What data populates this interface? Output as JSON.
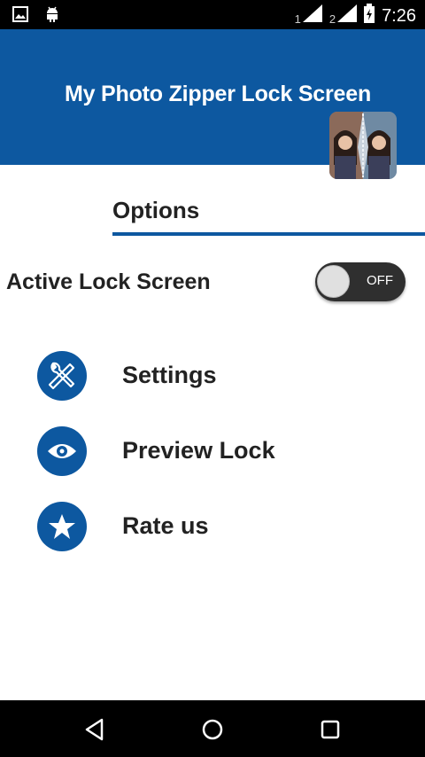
{
  "status_bar": {
    "sim1": "1",
    "sim2": "2",
    "time": "7:26",
    "icons": [
      "gallery-icon",
      "android-icon",
      "signal-icon",
      "signal-icon",
      "battery-icon"
    ]
  },
  "header": {
    "title": "My Photo Zipper Lock Screen",
    "color": "#0d58a0"
  },
  "options": {
    "title": "Options"
  },
  "active_lock": {
    "label": "Active Lock Screen",
    "toggle_text": "OFF",
    "enabled": false
  },
  "menu": [
    {
      "label": "Settings",
      "icon": "tools-icon"
    },
    {
      "label": "Preview Lock",
      "icon": "eye-icon"
    },
    {
      "label": "Rate us",
      "icon": "star-icon"
    }
  ],
  "nav": {
    "icons": [
      "back-icon",
      "home-icon",
      "recents-icon"
    ]
  }
}
